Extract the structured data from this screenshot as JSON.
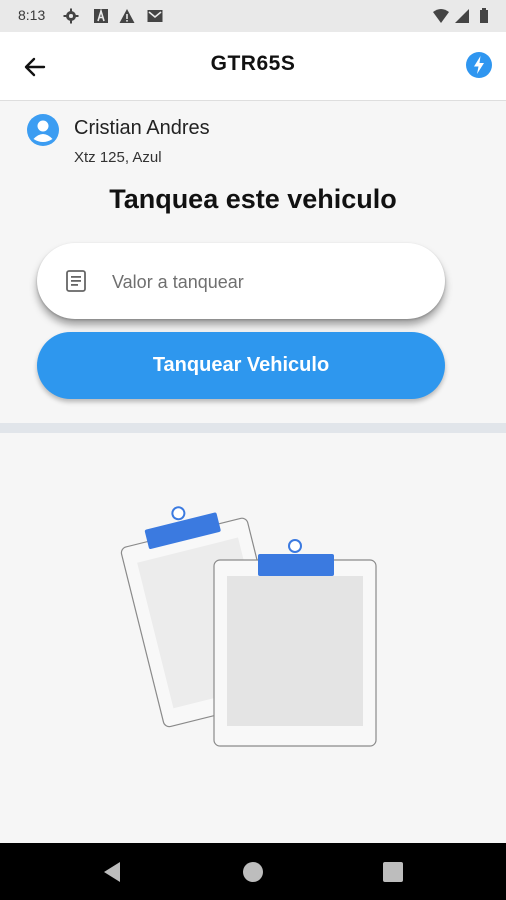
{
  "status_bar": {
    "time": "8:13",
    "left_icons": [
      "gear-icon",
      "text-a-icon",
      "warning-icon",
      "mail-icon"
    ],
    "right_icons": [
      "wifi-icon",
      "signal-icon",
      "battery-icon"
    ]
  },
  "app_bar": {
    "title": "GTR65S",
    "back_icon": "arrow-left-icon",
    "action_icon": "lightning-bolt-icon",
    "accent_color": "#2f96f0"
  },
  "user": {
    "name": "Cristian Andres",
    "vehicle": "Xtz 125, Azul",
    "avatar_icon": "account-circle-icon"
  },
  "form": {
    "heading": "Tanquea este vehiculo",
    "amount_placeholder": "Valor a tanquear",
    "amount_value": "",
    "field_icon": "document-icon",
    "submit_label": "Tanquear Vehiculo",
    "button_color": "#2e97ee"
  },
  "empty_state": {
    "illustration": "clipboards-illustration"
  },
  "nav_bar": {
    "buttons": [
      "back-triangle-icon",
      "home-circle-icon",
      "recents-square-icon"
    ]
  }
}
